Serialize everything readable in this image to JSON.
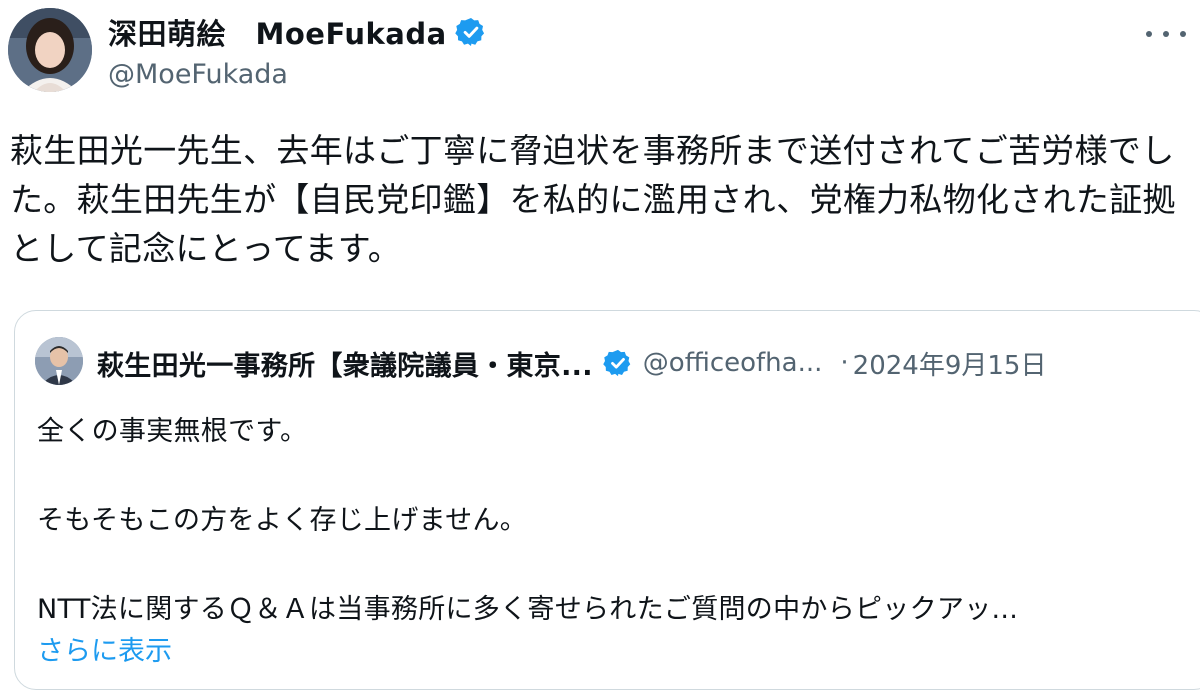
{
  "author": {
    "display_name": "深田萌絵　MoeFukada",
    "handle": "@MoeFukada",
    "verified": true,
    "avatar_icon": "profile-photo-avatar"
  },
  "post": {
    "text": "萩生田光一先生、去年はご丁寧に脅迫状を事務所まで送付されてご苦労様でした。萩生田先生が【自民党印鑑】を私的に濫用され、党権力私物化された証拠として記念にとってます。"
  },
  "quoted_post": {
    "author": {
      "display_name": "萩生田光一事務所【衆議院議員・東京...",
      "handle": "@officeofha...",
      "verified": true,
      "avatar_icon": "profile-photo-avatar"
    },
    "separator": "·",
    "date": "2024年9月15日",
    "lines": [
      "全くの事実無根です。",
      "そもそもこの方をよく存じ上げません。",
      "NTT法に関するＱ＆Ａは当事務所に多く寄せられたご質問の中からピックアッ..."
    ],
    "show_more_label": "さらに表示"
  },
  "icons": {
    "more": "more-horizontal-icon",
    "verified": "verified-badge-icon"
  },
  "colors": {
    "accent": "#1d9bf0",
    "secondary_text": "#536471",
    "border": "#cfd9de",
    "text": "#0f1419"
  }
}
